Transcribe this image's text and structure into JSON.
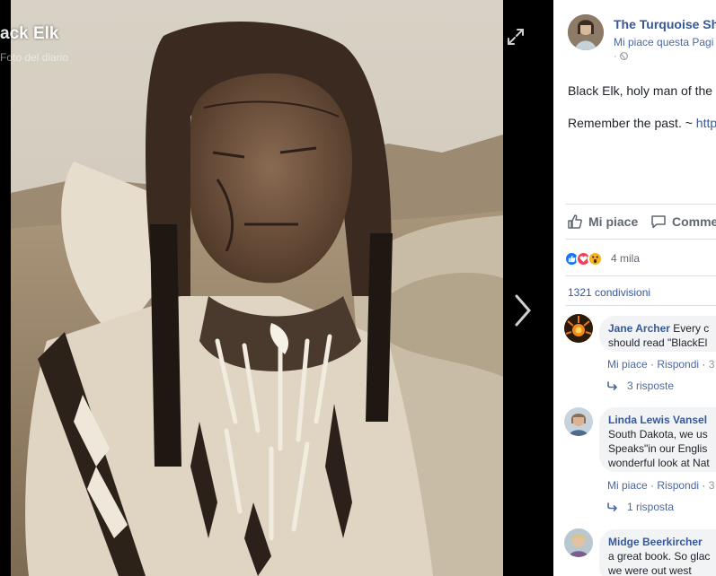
{
  "photo": {
    "title": "ack Elk",
    "subtitle": "Foto del diario"
  },
  "post": {
    "page_name": "The Turquoise Sh",
    "like_page": "Mi piace questa Pagi",
    "meta": "·",
    "text_line1": "Black Elk, holy man of the",
    "text_line2_prefix": "Remember the past. ~ ",
    "text_line2_link": "http"
  },
  "actions": {
    "like": "Mi piace",
    "comment": "Comme"
  },
  "reactions": {
    "icons": [
      "like-icon",
      "love-icon",
      "wow-icon"
    ],
    "count": "4 mila"
  },
  "shares": "1321 condivisioni",
  "comments": [
    {
      "author": "Jane Archer",
      "text1": " Every c",
      "text2": "should read \"BlackEl",
      "like": "Mi piace",
      "reply": "Rispondi",
      "time": "3",
      "replies": "3 risposte"
    },
    {
      "author": "Linda Lewis Vansel",
      "text1": "South Dakota, we us",
      "text2": "Speaks\"in our Englis",
      "text3": "wonderful look at Nat",
      "like": "Mi piace",
      "reply": "Rispondi",
      "time": "3",
      "replies": "1 risposta"
    },
    {
      "author": "Midge Beerkircher",
      "text1": "a great book. So glac",
      "text2": "we were out west"
    }
  ],
  "colors": {
    "link": "#365899",
    "like_blue": "#1877f2",
    "love_red": "#f33e58",
    "wow_yellow": "#f7b125"
  }
}
